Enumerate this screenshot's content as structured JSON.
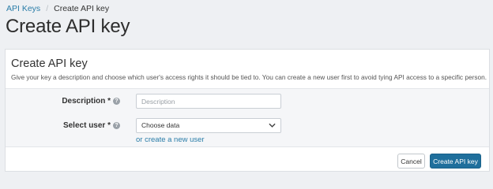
{
  "breadcrumb": {
    "parent_label": "API Keys",
    "separator": "/",
    "current_label": "Create API key"
  },
  "page": {
    "title": "Create API key"
  },
  "card": {
    "title": "Create API key",
    "description": "Give your key a description and choose which user's access rights it should be tied to. You can create a new user first to avoid tying API access to a specific person."
  },
  "form": {
    "description_label": "Description *",
    "description_placeholder": "Description",
    "description_value": "",
    "user_label": "Select user *",
    "user_selected": "Choose data",
    "create_user_link": "or create a new user",
    "help_glyph": "?"
  },
  "actions": {
    "cancel_label": "Cancel",
    "create_label": "Create API key"
  },
  "colors": {
    "accent": "#1f6f9c",
    "link": "#2a7da8",
    "page_bg": "#eef0f3"
  },
  "icons": {
    "help": "help-circle-icon",
    "select_arrow": "chevron-down-icon"
  }
}
